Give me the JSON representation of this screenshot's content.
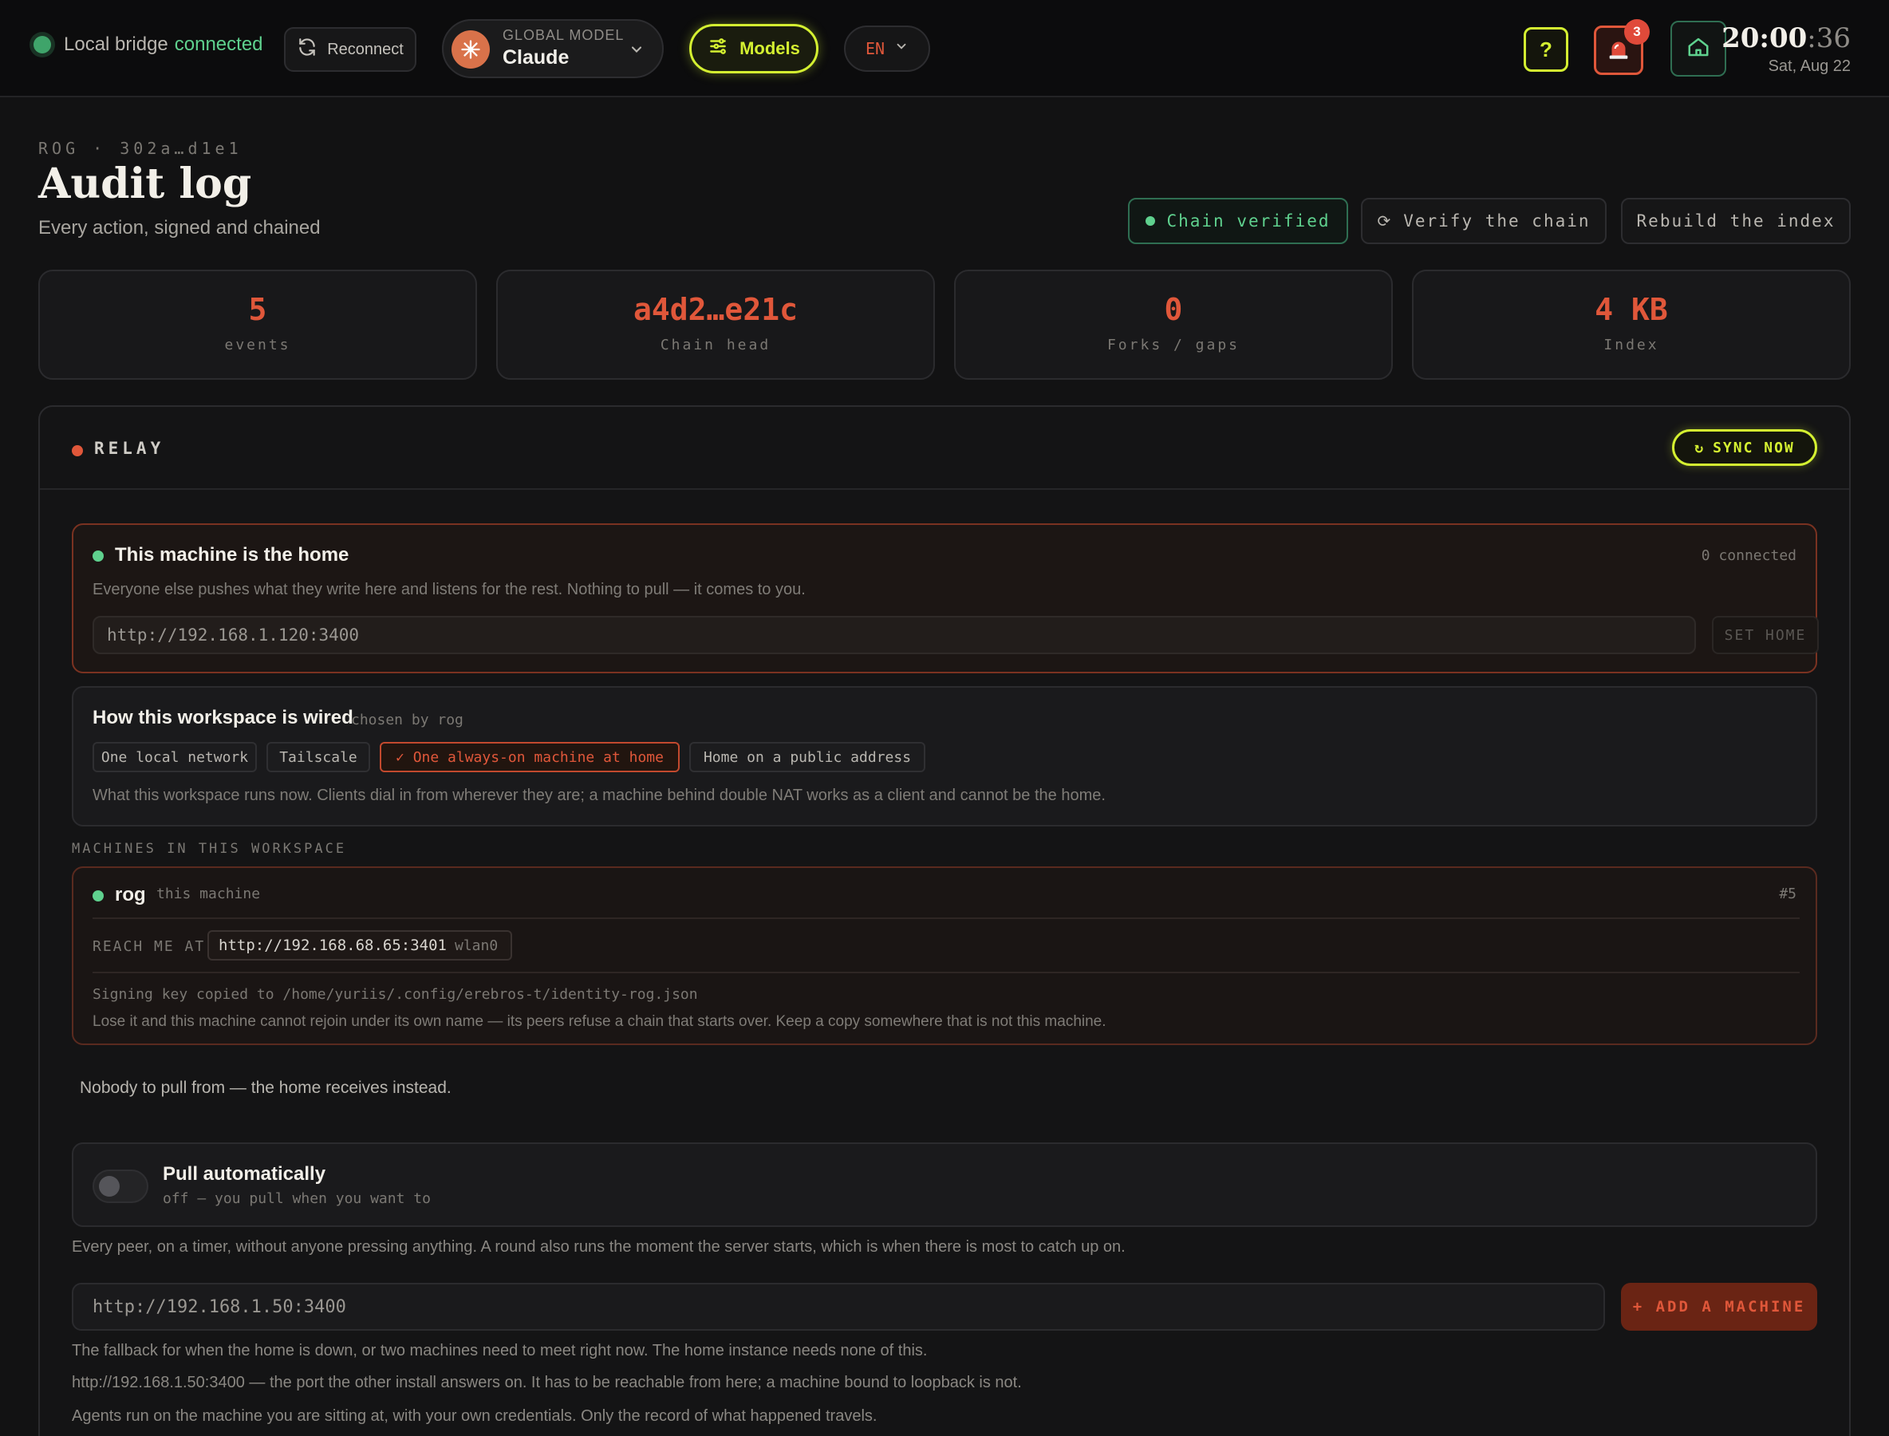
{
  "topbar": {
    "bridge_label": "Local bridge",
    "bridge_status": "connected",
    "reconnect_label": "Reconnect",
    "model_caption": "GLOBAL MODEL",
    "model_name": "Claude",
    "models_label": "Models",
    "lang": "EN",
    "help_label": "?",
    "alert_count": "3",
    "clock_hm": "20:00",
    "clock_sec": ":36",
    "clock_date": "Sat, Aug 22"
  },
  "header": {
    "breadcrumb": "ROG · 302a…d1e1",
    "title": "Audit log",
    "subtitle": "Every action, signed and chained",
    "chain_verified": "Chain verified",
    "verify_chain": "Verify the chain",
    "rebuild_index": "Rebuild the index"
  },
  "stats": [
    {
      "value": "5",
      "label": "events"
    },
    {
      "value": "a4d2…e21c",
      "label": "Chain head"
    },
    {
      "value": "0",
      "label": "Forks / gaps"
    },
    {
      "value": "4 KB",
      "label": "Index"
    }
  ],
  "relay": {
    "title": "RELAY",
    "sync_label": "SYNC NOW",
    "home": {
      "title": "This machine is the home",
      "connected": "0 connected",
      "description": "Everyone else pushes what they write here and listens for the rest. Nothing to pull — it comes to you.",
      "url_placeholder": "http://192.168.1.120:3400",
      "set_home": "SET HOME"
    },
    "wiring": {
      "title": "How this workspace is wired",
      "chosen_by": "chosen by rog",
      "options": [
        "One local network",
        "Tailscale",
        "✓ One always-on machine at home",
        "Home on a public address"
      ],
      "description": "What this workspace runs now. Clients dial in from wherever they are; a machine behind double NAT works as a client and cannot be the home."
    },
    "machines_label": "MACHINES IN THIS WORKSPACE",
    "machine": {
      "name": "rog",
      "tag": "this machine",
      "id": "#5",
      "reach_label": "REACH ME AT",
      "reach_url": "http://192.168.68.65:3401",
      "reach_iface": "wlan0",
      "key_note": "Signing key copied to /home/yuriis/.config/erebros-t/identity-rog.json",
      "warning": "Lose it and this machine cannot rejoin under its own name — its peers refuse a chain that starts over. Keep a copy somewhere that is not this machine."
    },
    "nobody_note": "Nobody to pull from — the home receives instead.",
    "pull": {
      "title": "Pull automatically",
      "state": "off — you pull when you want to",
      "description": "Every peer, on a timer, without anyone pressing anything. A round also runs the moment the server starts, which is when there is most to catch up on."
    },
    "peer_placeholder": "http://192.168.1.50:3400",
    "add_machine": "+ ADD A MACHINE",
    "notes": [
      "The fallback for when the home is down, or two machines need to meet right now. The home instance needs none of this.",
      "http://192.168.1.50:3400 — the port the other install answers on. It has to be reachable from here; a machine bound to loopback is not.",
      "Agents run on the machine you are sitting at, with your own credentials. Only the record of what happened travels."
    ]
  },
  "colors": {
    "accent_lime": "#d4f031",
    "accent_orange": "#e0573a",
    "status_green": "#5fd18e",
    "background": "#121213"
  }
}
